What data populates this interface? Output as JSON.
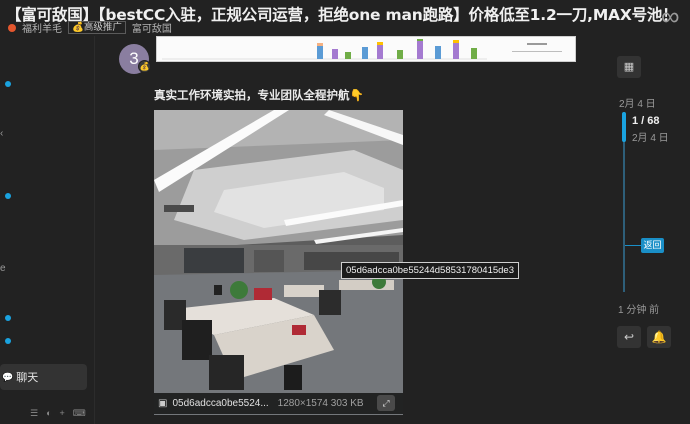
{
  "header": {
    "title": "【富可敌国】【bestCC入驻，正规公司运营，拒绝one man跑路】价格低至1.2一刀,MAX号池！",
    "category": "福利羊毛",
    "tags": [
      "高级推广",
      "富可敌国"
    ]
  },
  "sidebar": {
    "glyphs": [
      "‹",
      "e"
    ],
    "chat_label": "聊天",
    "footer_icons": [
      "filter-icon",
      "theme-icon",
      "plus-icon",
      "keyboard-icon"
    ]
  },
  "post": {
    "avatar_letter": "3",
    "text": "真实工作环境实拍，专业团队全程护航👇",
    "image": {
      "filename": "05d6adcca0be5524...",
      "dimensions": "1280×1574 303 KB",
      "tooltip": "05d6adcca0be55244d58531780415de3"
    }
  },
  "timeline": {
    "top_date": "2月 4 日",
    "position": "1 / 68",
    "position_date": "2月 4 日",
    "back_label": "返回",
    "bottom_date": "1 分钟 前",
    "progress": 0.015
  },
  "colors": {
    "background": "#222222",
    "accent": "#1aa3e0",
    "category": "#e4572e"
  }
}
